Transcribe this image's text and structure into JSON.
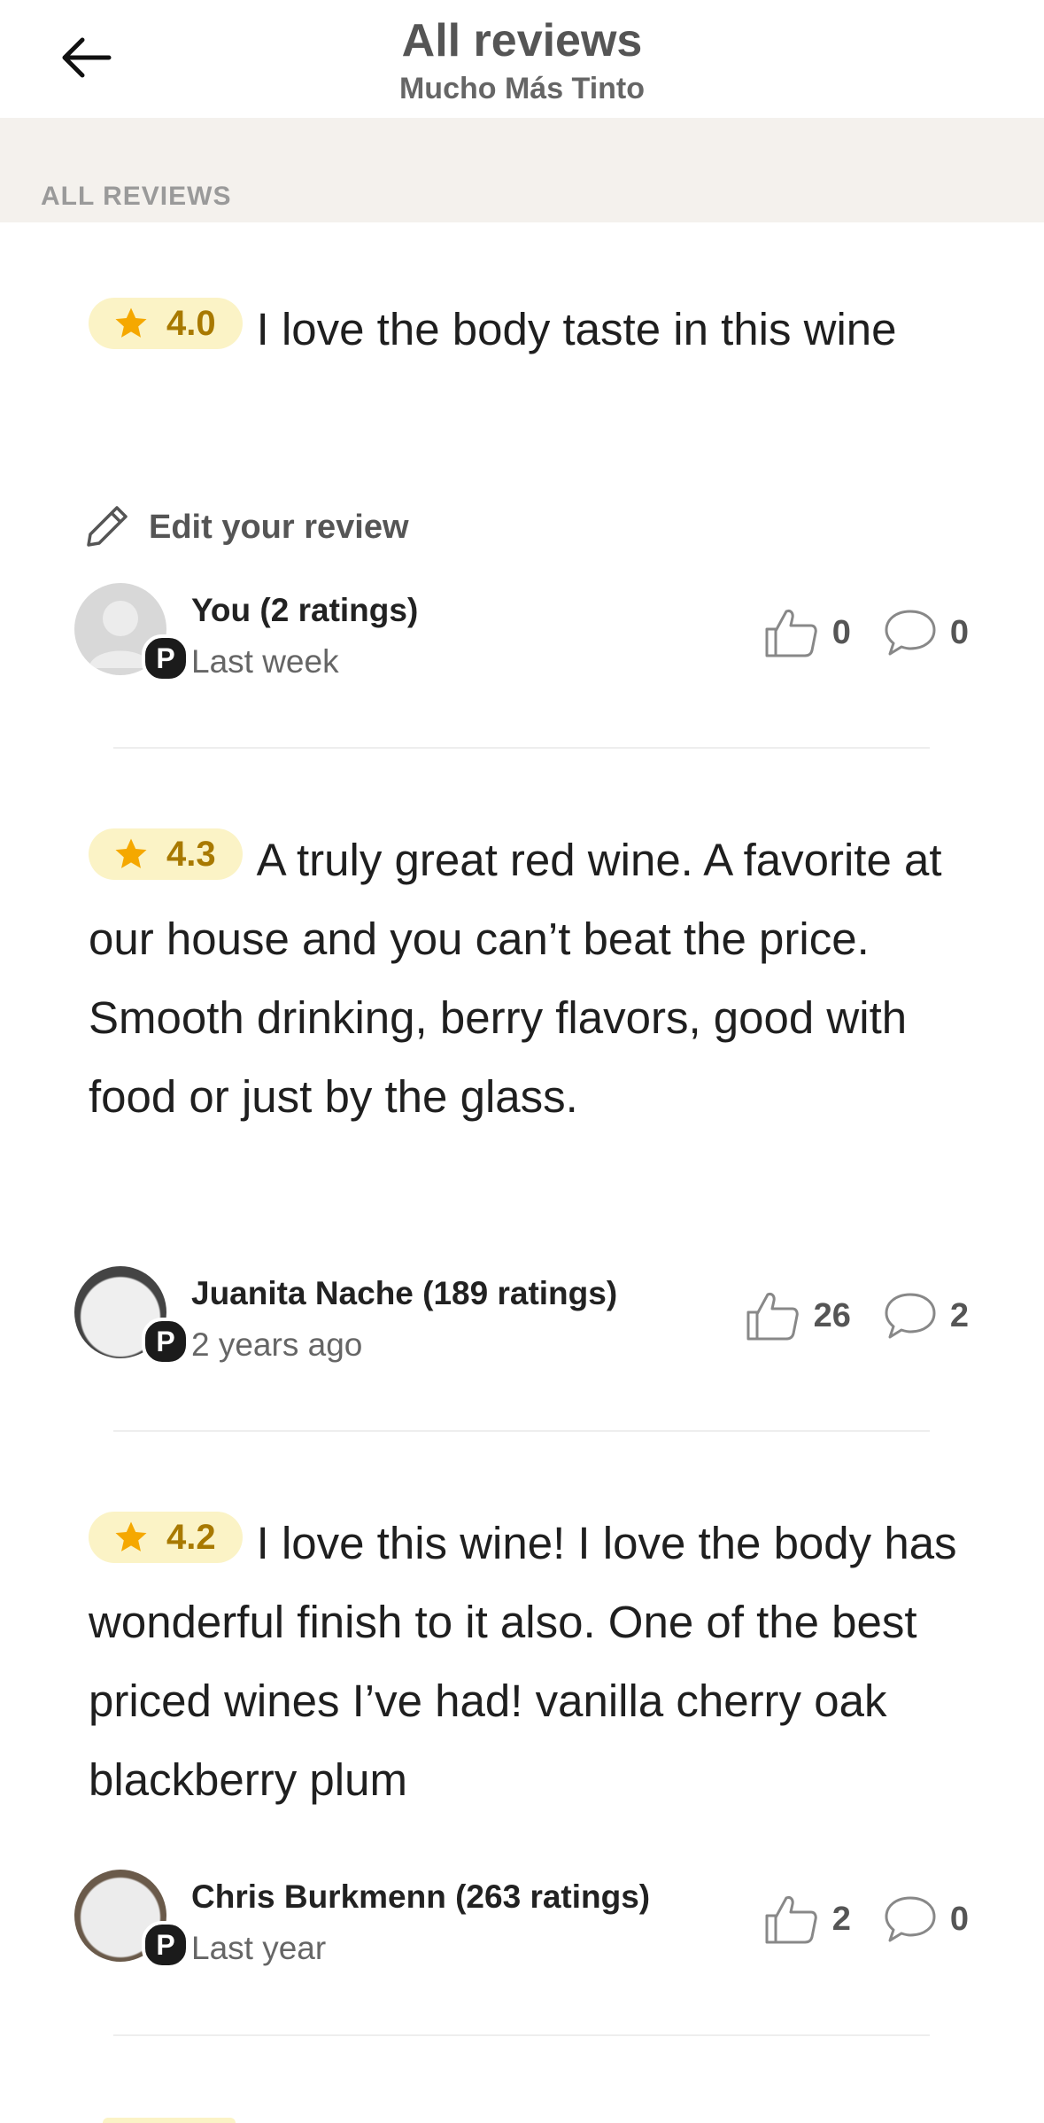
{
  "header": {
    "title": "All reviews",
    "subtitle": "Mucho Más Tinto"
  },
  "section": {
    "label": "ALL REVIEWS"
  },
  "edit": {
    "label": "Edit your review"
  },
  "reviews": [
    {
      "rating": "4.0",
      "text": "I love the body taste in this wine",
      "author": "You (2 ratings)",
      "time": "Last week",
      "likes": "0",
      "comments": "0"
    },
    {
      "rating": "4.3",
      "text": "A truly great red wine. A favorite at our house and you can’t beat the price. Smooth drinking, berry flavors, good with food or just by the glass.",
      "author": "Juanita Nache (189 ratings)",
      "time": "2 years ago",
      "likes": "26",
      "comments": "2"
    },
    {
      "rating": "4.2",
      "text": "I love this wine! I love the body has wonderful finish to it also. One of the best priced wines I’ve had! vanilla cherry oak blackberry plum",
      "author": "Chris Burkmenn (263 ratings)",
      "time": "Last year",
      "likes": "2",
      "comments": "0"
    }
  ],
  "badge_letter": "P",
  "colors": {
    "accent_star": "#f5a800",
    "pill_bg": "#fbf3c6",
    "rating_text": "#a87900",
    "section_bg": "#f4f1ed"
  }
}
